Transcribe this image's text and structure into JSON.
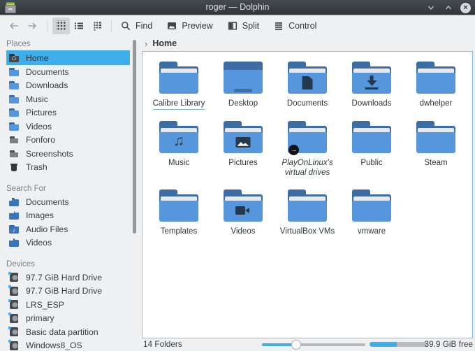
{
  "window": {
    "title": "roger — Dolphin"
  },
  "icons": {
    "breadcrumb_chevron": "›",
    "close": "×",
    "symlink_arrow": "→",
    "home_glyph": "⌂",
    "music_note_small": "♪",
    "music_note_big": "♫"
  },
  "toolbar": {
    "find_label": "Find",
    "preview_label": "Preview",
    "split_label": "Split",
    "control_label": "Control"
  },
  "breadcrumb": {
    "current": "Home"
  },
  "sidebar": {
    "sections": [
      {
        "title": "Places",
        "items": [
          {
            "label": "Home",
            "icon": "user-home",
            "glyph": "⌂",
            "selected": true
          },
          {
            "label": "Documents",
            "icon": "folder"
          },
          {
            "label": "Downloads",
            "icon": "folder"
          },
          {
            "label": "Music",
            "icon": "folder"
          },
          {
            "label": "Pictures",
            "icon": "folder"
          },
          {
            "label": "Videos",
            "icon": "folder"
          },
          {
            "label": "Fonforo",
            "icon": "folder-grey"
          },
          {
            "label": "Screenshots",
            "icon": "folder-grey"
          },
          {
            "label": "Trash",
            "icon": "trash"
          }
        ]
      },
      {
        "title": "Search For",
        "items": [
          {
            "label": "Documents",
            "icon": "search-doc"
          },
          {
            "label": "Images",
            "icon": "search-img"
          },
          {
            "label": "Audio Files",
            "icon": "search-music",
            "glyph": "♪"
          },
          {
            "label": "Videos",
            "icon": "search-video"
          }
        ]
      },
      {
        "title": "Devices",
        "items": [
          {
            "label": "97.7 GiB Hard Drive",
            "icon": "drive"
          },
          {
            "label": "97.7 GiB Hard Drive",
            "icon": "drive"
          },
          {
            "label": "LRS_ESP",
            "icon": "drive"
          },
          {
            "label": "primary",
            "icon": "drive"
          },
          {
            "label": "Basic data partition",
            "icon": "drive"
          },
          {
            "label": "Windows8_OS",
            "icon": "drive"
          }
        ]
      }
    ]
  },
  "main": {
    "folders": [
      {
        "name": "Calibre Library",
        "variant": "plain",
        "hover": true
      },
      {
        "name": "Desktop",
        "variant": "desktop"
      },
      {
        "name": "Documents",
        "variant": "doc"
      },
      {
        "name": "Downloads",
        "variant": "down"
      },
      {
        "name": "dwhelper",
        "variant": "plain"
      },
      {
        "name": "Music",
        "variant": "music",
        "glyph": "♫"
      },
      {
        "name": "Pictures",
        "variant": "img"
      },
      {
        "name": "PlayOnLinux's virtual drives",
        "variant": "plain",
        "symlink": true,
        "italic": true
      },
      {
        "name": "Public",
        "variant": "plain"
      },
      {
        "name": "Steam",
        "variant": "plain"
      },
      {
        "name": "Templates",
        "variant": "plain"
      },
      {
        "name": "Videos",
        "variant": "video"
      },
      {
        "name": "VirtualBox VMs",
        "variant": "plain"
      },
      {
        "name": "vmware",
        "variant": "plain"
      }
    ]
  },
  "statusbar": {
    "folders_text": "14 Folders",
    "free_text": "39.9 GiB free",
    "zoom_percent": 33,
    "disk_used_percent": 48
  },
  "colors": {
    "accent": "#3daee9",
    "folder_body": "#5596dd",
    "folder_dark": "#3e6da6",
    "titlebar": "#31363b"
  }
}
